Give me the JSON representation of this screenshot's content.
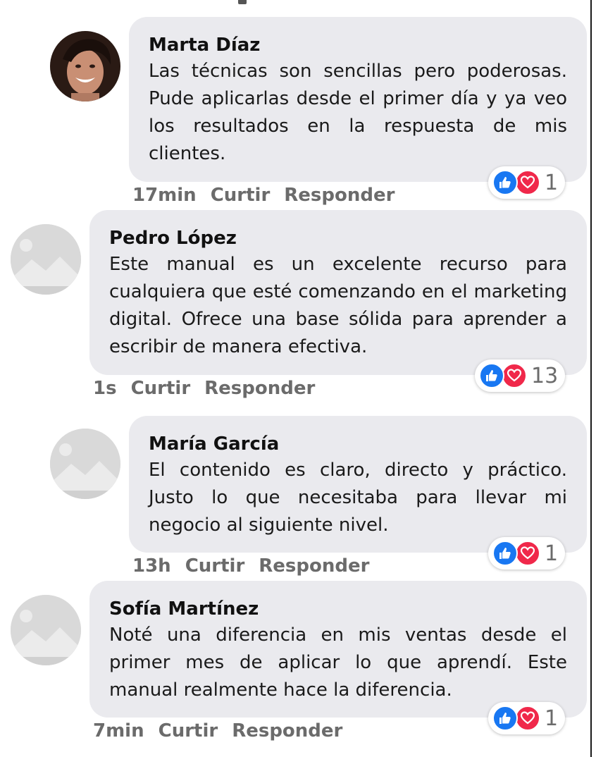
{
  "comments": [
    {
      "author": "Marta Díaz",
      "text": "Las técnicas son sencillas pero poderosas. Pude aplicarlas desde el primer día y ya veo los resultados en la respuesta de mis clientes.",
      "time": "17min",
      "like_label": "Curtir",
      "reply_label": "Responder",
      "reaction_count": "1",
      "avatar": "photo-avatar"
    },
    {
      "author": "Pedro López",
      "text": "Este manual es un excelente recurso para cualquiera que esté comenzando en el marketing digital. Ofrece una base sólida para aprender a escribir de manera efectiva.",
      "time": "1s",
      "like_label": "Curtir",
      "reply_label": "Responder",
      "reaction_count": "13",
      "avatar": "placeholder-avatar"
    },
    {
      "author": "María García",
      "text": "El contenido es claro, directo y práctico. Justo lo que necesitaba para llevar mi negocio al siguiente nivel.",
      "time": "13h",
      "like_label": "Curtir",
      "reply_label": "Responder",
      "reaction_count": "1",
      "avatar": "placeholder-avatar"
    },
    {
      "author": "Sofía Martínez",
      "text": "Noté una diferencia en mis ventas desde el primer mes de aplicar lo que aprendí. Este manual realmente hace la diferencia.",
      "time": "7min",
      "like_label": "Curtir",
      "reply_label": "Responder",
      "reaction_count": "1",
      "avatar": "placeholder-avatar"
    }
  ],
  "reaction_icons": [
    "thumbs-up-icon",
    "heart-icon"
  ],
  "colors": {
    "bubble": "#eaeaee",
    "like": "#1877f2",
    "love": "#f0284a",
    "meta": "#6b6b6b"
  }
}
